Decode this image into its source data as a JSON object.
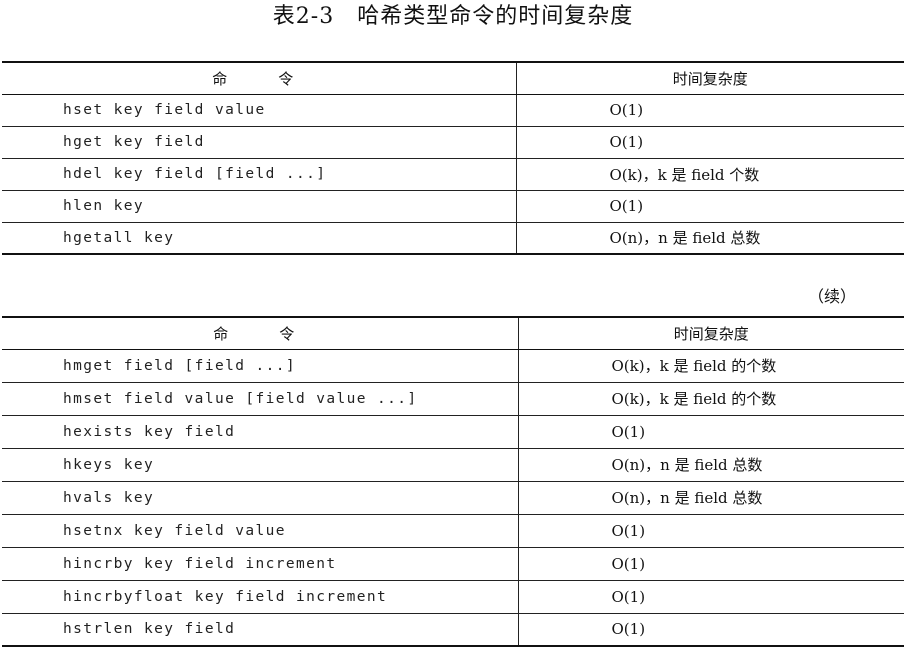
{
  "caption": "表2-3　哈希类型命令的时间复杂度",
  "continued": "（续）",
  "header": {
    "command": "命　令",
    "complexity": "时间复杂度"
  },
  "table1": [
    {
      "cmd": "hset key field value",
      "cx": "O(1)"
    },
    {
      "cmd": "hget key field",
      "cx": "O(1)"
    },
    {
      "cmd": "hdel key field [field ...]",
      "cx": "O(k)，k 是 field 个数"
    },
    {
      "cmd": "hlen key",
      "cx": "O(1)"
    },
    {
      "cmd": "hgetall key",
      "cx": "O(n)，n 是 field 总数"
    }
  ],
  "table2": [
    {
      "cmd": "hmget field [field ...]",
      "cx": "O(k)，k 是 field 的个数"
    },
    {
      "cmd": "hmset field value [field value ...]",
      "cx": "O(k)，k 是 field 的个数"
    },
    {
      "cmd": "hexists key field",
      "cx": "O(1)"
    },
    {
      "cmd": "hkeys key",
      "cx": "O(n)，n 是 field 总数"
    },
    {
      "cmd": "hvals key",
      "cx": "O(n)，n 是 field 总数"
    },
    {
      "cmd": "hsetnx key field value",
      "cx": "O(1)"
    },
    {
      "cmd": "hincrby key field increment",
      "cx": "O(1)"
    },
    {
      "cmd": "hincrbyfloat key field increment",
      "cx": "O(1)"
    },
    {
      "cmd": "hstrlen key field",
      "cx": "O(1)"
    }
  ]
}
